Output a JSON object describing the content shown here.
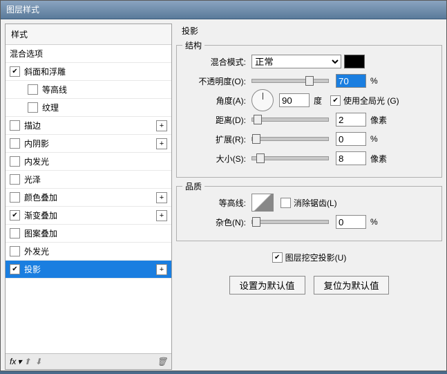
{
  "window": {
    "title": "图层样式"
  },
  "left": {
    "styles_header": "样式",
    "blend_header": "混合选项",
    "items": [
      {
        "label": "斜面和浮雕",
        "checked": true,
        "plus": false,
        "sub": false
      },
      {
        "label": "等高线",
        "checked": false,
        "plus": false,
        "sub": true
      },
      {
        "label": "纹理",
        "checked": false,
        "plus": false,
        "sub": true
      },
      {
        "label": "描边",
        "checked": false,
        "plus": true,
        "sub": false
      },
      {
        "label": "内阴影",
        "checked": false,
        "plus": true,
        "sub": false
      },
      {
        "label": "内发光",
        "checked": false,
        "plus": false,
        "sub": false
      },
      {
        "label": "光泽",
        "checked": false,
        "plus": false,
        "sub": false
      },
      {
        "label": "颜色叠加",
        "checked": false,
        "plus": true,
        "sub": false
      },
      {
        "label": "渐变叠加",
        "checked": true,
        "plus": true,
        "sub": false
      },
      {
        "label": "图案叠加",
        "checked": false,
        "plus": false,
        "sub": false
      },
      {
        "label": "外发光",
        "checked": false,
        "plus": false,
        "sub": false
      },
      {
        "label": "投影",
        "checked": true,
        "plus": true,
        "sub": false,
        "selected": true
      }
    ],
    "fx": "fx"
  },
  "panel": {
    "title": "投影",
    "structure": {
      "legend": "结构",
      "blend_label": "混合模式:",
      "blend_value": "正常",
      "opacity_label": "不透明度(O):",
      "opacity_value": "70",
      "opacity_unit": "%",
      "angle_label": "角度(A):",
      "angle_value": "90",
      "angle_unit": "度",
      "global_label": "使用全局光 (G)",
      "global_checked": true,
      "distance_label": "距离(D):",
      "distance_value": "2",
      "distance_unit": "像素",
      "spread_label": "扩展(R):",
      "spread_value": "0",
      "spread_unit": "%",
      "size_label": "大小(S):",
      "size_value": "8",
      "size_unit": "像素"
    },
    "quality": {
      "legend": "品质",
      "contour_label": "等高线:",
      "antialias_label": "消除锯齿(L)",
      "antialias_checked": false,
      "noise_label": "杂色(N):",
      "noise_value": "0",
      "noise_unit": "%"
    },
    "knockout_label": "图层挖空投影(U)",
    "knockout_checked": true,
    "make_default": "设置为默认值",
    "reset_default": "复位为默认值"
  }
}
